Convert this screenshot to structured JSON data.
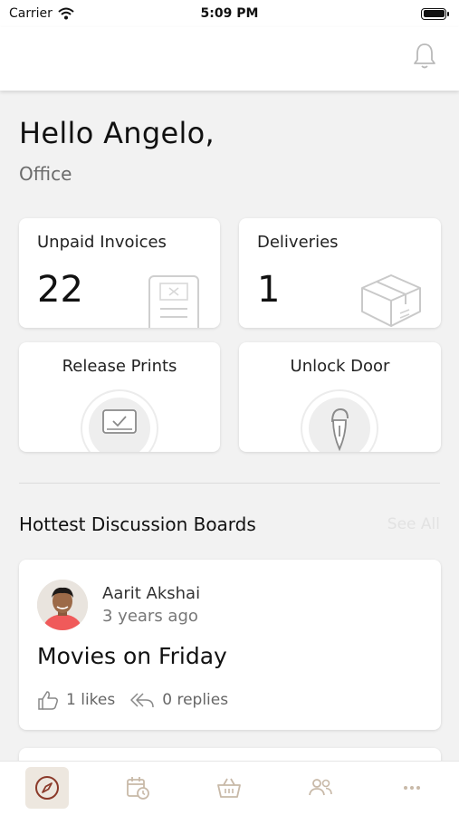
{
  "status_bar": {
    "carrier": "Carrier",
    "time": "5:09 PM"
  },
  "greeting": {
    "hello": "Hello Angelo,",
    "location": "Office"
  },
  "cards": {
    "unpaid_invoices": {
      "title": "Unpaid Invoices",
      "count": "22",
      "icon": "invoice-icon"
    },
    "deliveries": {
      "title": "Deliveries",
      "count": "1",
      "icon": "package-icon"
    },
    "release_prints": {
      "title": "Release Prints",
      "icon": "print-icon"
    },
    "unlock_door": {
      "title": "Unlock Door",
      "icon": "lock-icon"
    }
  },
  "discussion": {
    "section_title": "Hottest Discussion Boards",
    "see_all": "See All",
    "post": {
      "author": "Aarit Akshai",
      "time": "3 years ago",
      "title": "Movies on Friday",
      "likes": "1 likes",
      "replies": "0 replies"
    }
  },
  "tabs": [
    {
      "name": "explore",
      "icon": "compass-icon",
      "active": true
    },
    {
      "name": "bookings",
      "icon": "calendar-clock-icon",
      "active": false
    },
    {
      "name": "shop",
      "icon": "basket-icon",
      "active": false
    },
    {
      "name": "community",
      "icon": "people-icon",
      "active": false
    },
    {
      "name": "more",
      "icon": "more-icon",
      "active": false
    }
  ],
  "colors": {
    "accent": "#8b3a2a",
    "inactive_tab": "#c8b9a8",
    "background": "#f2f2f2"
  }
}
